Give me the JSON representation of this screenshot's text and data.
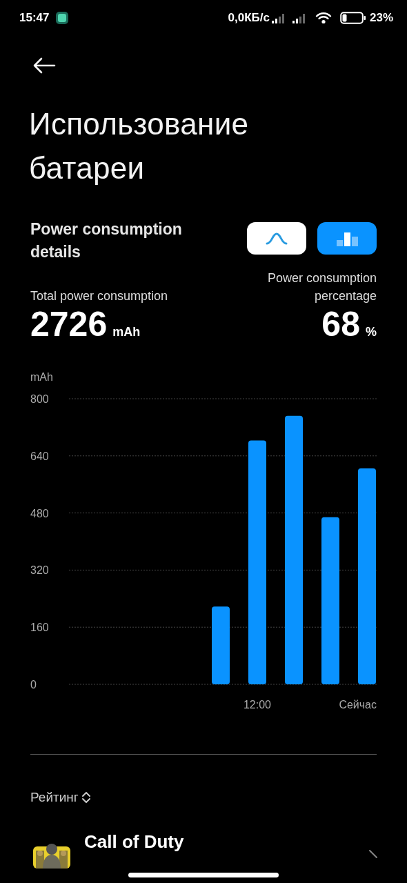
{
  "status_bar": {
    "time": "15:47",
    "network_speed": "0,0КБ/с",
    "battery_text": "23%"
  },
  "title": "Использование батареи",
  "section_title": "Power consumption details",
  "view_buttons": [
    {
      "kind": "curve",
      "selected": false
    },
    {
      "kind": "bars",
      "selected": true
    }
  ],
  "total": {
    "label": "Total power consumption",
    "value": "2726",
    "unit": "mAh"
  },
  "percentage": {
    "label": "Power consumption percentage",
    "value": "68",
    "unit": "%"
  },
  "chart": {
    "chart_data": {
      "type": "bar",
      "ylabel": "mAh",
      "categories": [
        null,
        null,
        null,
        null,
        null,
        "12:00",
        null,
        null,
        "Сейчас"
      ],
      "series": [
        {
          "color": "#0a93ff",
          "values": [
            null,
            null,
            null,
            null,
            218,
            683,
            752,
            468,
            605
          ]
        }
      ],
      "ylim": [
        0,
        800
      ],
      "yticks": [
        0,
        160,
        320,
        480,
        640,
        800
      ],
      "grid": true
    }
  },
  "sort": {
    "label": "Рейтинг"
  },
  "apps": [
    {
      "name": "Call of Duty"
    }
  ]
}
